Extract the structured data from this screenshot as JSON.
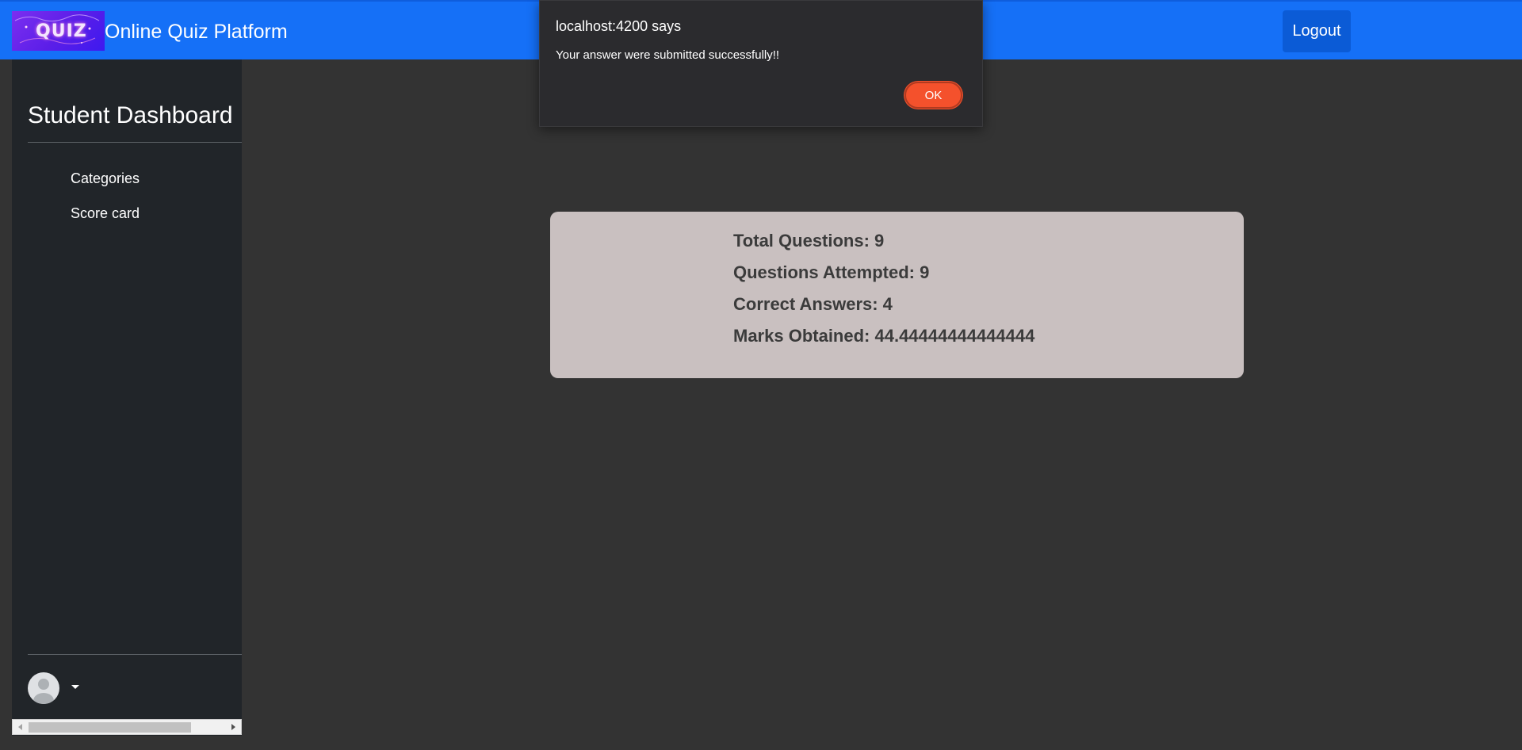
{
  "navbar": {
    "logo_text": "QUIZ",
    "brand": "Online Quiz Platform",
    "logout_label": "Logout"
  },
  "sidebar": {
    "title": "Student Dashboard",
    "items": [
      {
        "label": "Categories"
      },
      {
        "label": "Score card"
      }
    ]
  },
  "scorecard": {
    "total_questions": "Total Questions: 9",
    "questions_attempted": "Questions Attempted: 9",
    "correct_answers": "Correct Answers: 4",
    "marks_obtained": "Marks Obtained: 44.44444444444444"
  },
  "alert": {
    "title": "localhost:4200 says",
    "message": "Your answer were submitted successfully!!",
    "ok_label": "OK"
  },
  "colors": {
    "navbar": "#1570f7",
    "sidebar": "#212529",
    "page_background": "#333333",
    "scorecard_background": "#c9c0c0",
    "ok_button": "#f4512c"
  },
  "icons": {
    "avatar": "user-avatar-icon",
    "dropdown": "caret-down-icon"
  }
}
